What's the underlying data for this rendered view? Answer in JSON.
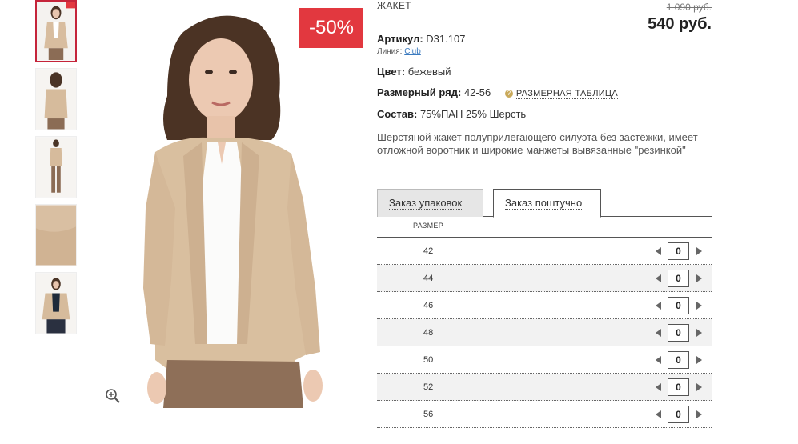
{
  "product": {
    "title": "ЖАКЕТ",
    "old_price": "1 090 руб.",
    "price": "540 руб.",
    "discount": "-50%",
    "sku_label": "Артикул:",
    "sku": "D31.107",
    "line_label": "Линия:",
    "line_value": "Club",
    "color_label": "Цвет:",
    "color_value": "бежевый",
    "size_range_label": "Размерный ряд:",
    "size_range_value": "42-56",
    "size_table_link": "РАЗМЕРНАЯ ТАБЛИЦА",
    "composition_label": "Состав:",
    "composition_value": "75%ПАН 25% Шерсть",
    "description": "Шерстяной жакет полуприлегающего силуэта без застёжки, имеет отложной воротник и широкие манжеты вывязанные \"резинкой\""
  },
  "tabs": [
    {
      "label": "Заказ упаковок"
    },
    {
      "label": "Заказ поштучно"
    }
  ],
  "size_header": "РАЗМЕР",
  "sizes": [
    {
      "size": "42",
      "qty": "0"
    },
    {
      "size": "44",
      "qty": "0"
    },
    {
      "size": "46",
      "qty": "0"
    },
    {
      "size": "48",
      "qty": "0"
    },
    {
      "size": "50",
      "qty": "0"
    },
    {
      "size": "52",
      "qty": "0"
    },
    {
      "size": "56",
      "qty": "0"
    }
  ],
  "colors": {
    "sale_badge": "#e2383f",
    "active_thumb_border": "#c5243a",
    "link": "#3a7abf"
  },
  "icons": {
    "zoom": "magnifier-plus-icon",
    "help": "question-dot-icon",
    "decrement": "triangle-left-icon",
    "increment": "triangle-right-icon"
  }
}
